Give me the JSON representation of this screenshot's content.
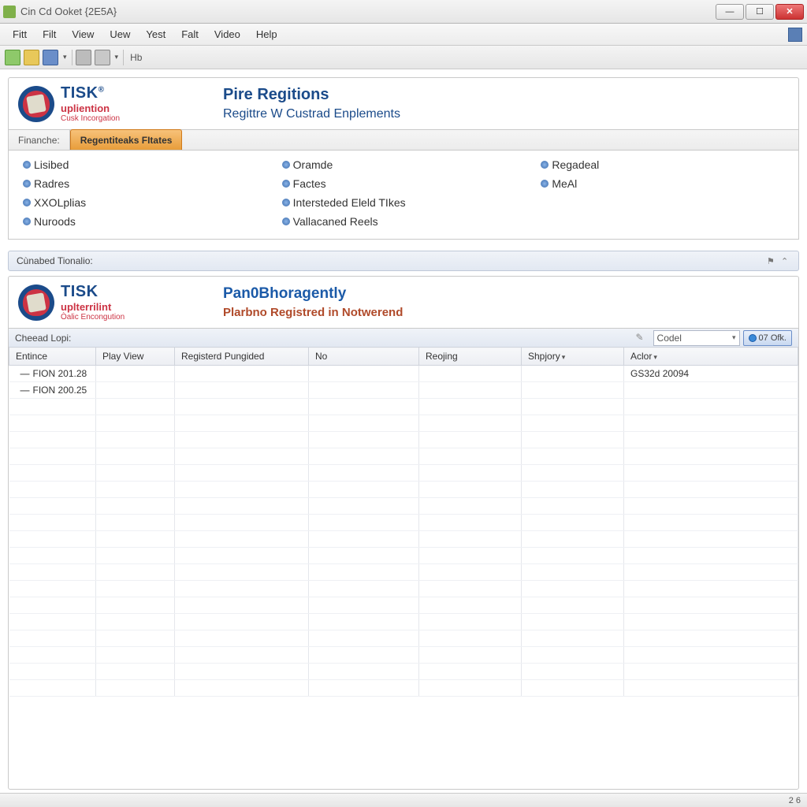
{
  "window": {
    "title": "Cin Cd Ooket {2E5A}"
  },
  "menu": [
    "Fitt",
    "Filt",
    "View",
    "Uew",
    "Yest",
    "Falt",
    "Video",
    "Help"
  ],
  "toolbar": {
    "hb": "Hb"
  },
  "panel1": {
    "brand": "TISK",
    "brand_sup": "®",
    "brand_sub": "upliention",
    "brand_sub2": "Cusk Incorgation",
    "title": "Pire Regitions",
    "subtitle": "Regittre W Custrad Enplements",
    "tabs": [
      {
        "label": "Finanche:",
        "active": false
      },
      {
        "label": "Regentiteaks FItates",
        "active": true
      }
    ],
    "links": [
      [
        "Lisibed",
        "Radres",
        "XXOLplias",
        "Nuroods"
      ],
      [
        "Oramde",
        "Factes",
        "Intersteded Eleld TIkes",
        "Vallacaned Reels"
      ],
      [
        "Regadeal",
        "MeAl"
      ]
    ]
  },
  "sectionbar": {
    "label": "Cùnabed Tionalio:"
  },
  "panel2": {
    "brand": "TISK",
    "brand_sub": "uplterrilint",
    "brand_sub2": "Òalic Encongution",
    "title": "Pan0Bhoragently",
    "subtitle": "Plarbno Registred in Notwerend",
    "subbar_label": "Cheead Lopi:",
    "codel_placeholder": "Codel",
    "btn_text": "07 Ofk.",
    "columns": [
      "Entince",
      "Play View",
      "Registerd Pungided",
      "No",
      "Reojing",
      "Shpjory",
      "Aclor"
    ],
    "rows": [
      {
        "entince": "FION 201.28",
        "aclor": "GS32d 20094"
      },
      {
        "entince": "FION 200.25",
        "aclor": ""
      }
    ]
  },
  "statusbar": {
    "text": "2 6"
  }
}
